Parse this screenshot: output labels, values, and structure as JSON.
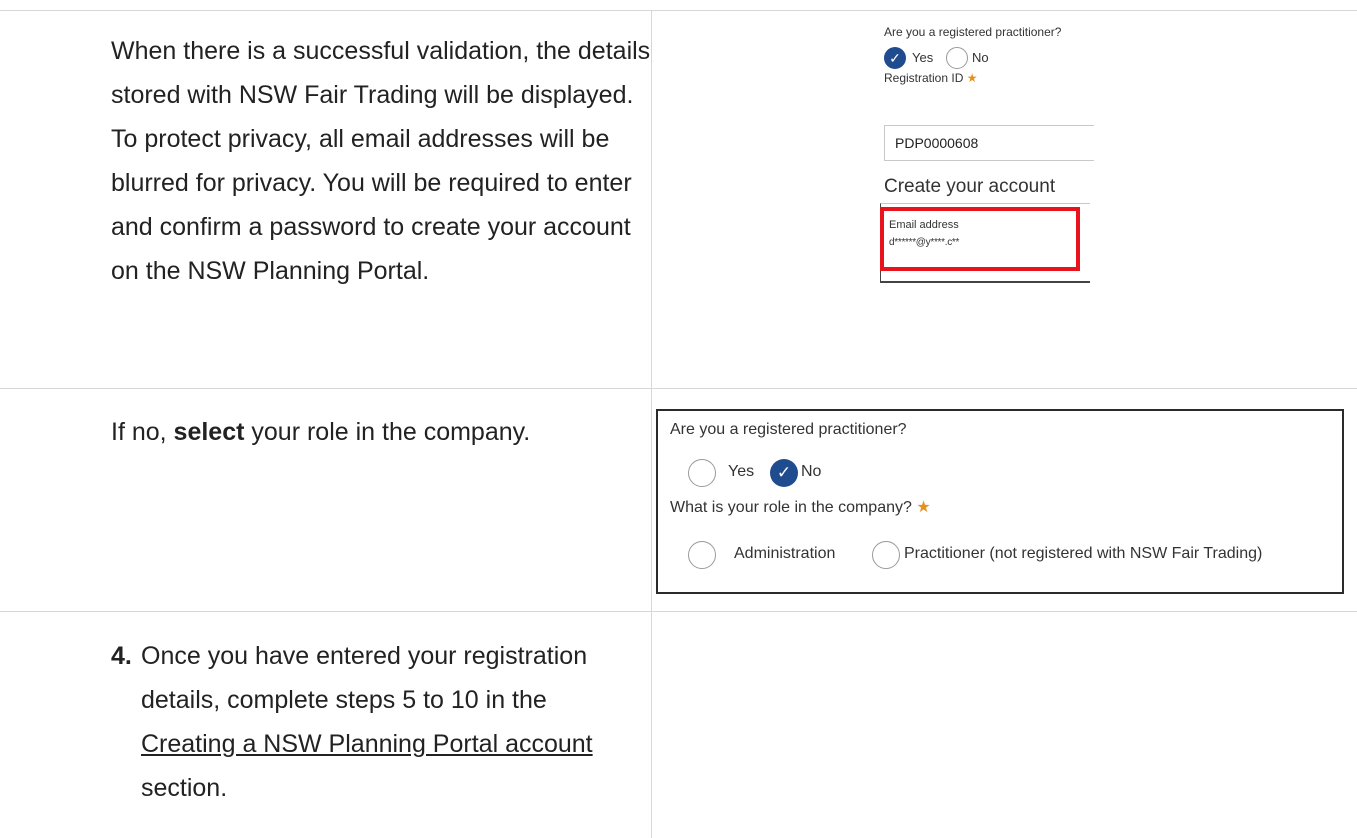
{
  "rows": [
    {
      "text": "When there is a successful validation, the details stored with NSW Fair Trading will be displayed. To protect privacy, all email addresses will be blurred for privacy. You will be required to enter and confirm a password to create your account on the NSW Planning Portal."
    },
    {
      "text_prefix": "If no,",
      "text_bold": "select",
      "text_suffix": "your role in the company."
    },
    {
      "step_number": "4.",
      "text_before_link": "Once you have entered your registration details, complete steps 5 to 10 in the",
      "link_text": "Creating a NSW Planning Portal account",
      "text_after_link": "section."
    }
  ],
  "screenshot_1": {
    "question": "Are you a registered practitioner?",
    "yes_label": "Yes",
    "no_label": "No",
    "selected": "Yes",
    "registration_id_label": "Registration ID",
    "required_mark": "★",
    "registration_id_value": "PDP0000608",
    "create_account_heading": "Create your account",
    "email_label": "Email address",
    "email_value": "d******@y****.c**",
    "highlight_color": "#e8141b"
  },
  "screenshot_2": {
    "question": "Are you a registered practitioner?",
    "yes_label": "Yes",
    "no_label": "No",
    "selected": "No",
    "role_question": "What is your role in the company?",
    "required_mark": "★",
    "role_options": [
      "Administration",
      "Practitioner (not registered with NSW Fair Trading)"
    ]
  },
  "colors": {
    "radio_selected": "#1f4b8f",
    "required_star": "#e4911e",
    "table_lines": "#d7d7d7"
  },
  "icons": {
    "check": "checkmark-icon"
  }
}
